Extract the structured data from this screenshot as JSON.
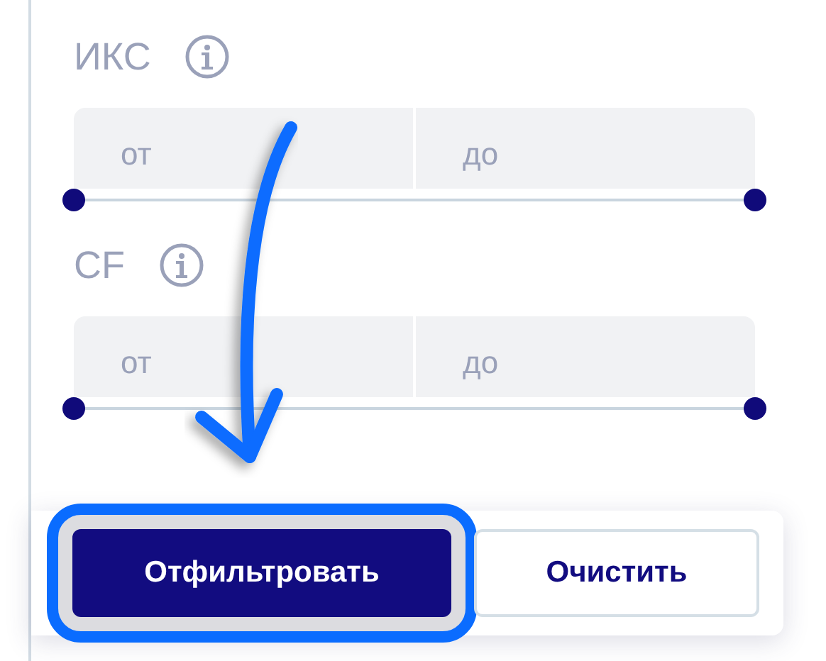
{
  "filters": [
    {
      "label": "ИКС",
      "from": {
        "placeholder": "от"
      },
      "to": {
        "placeholder": "до"
      },
      "slider": {
        "low": {
          "level": 0
        },
        "high": {
          "level": 1
        }
      }
    },
    {
      "label": "CF",
      "from": {
        "placeholder": "от"
      },
      "to": {
        "placeholder": "до"
      },
      "slider": {
        "low": {
          "level": 0
        },
        "high": {
          "level": 1
        }
      }
    }
  ],
  "buttons": [
    {
      "label": "Отфильтровать",
      "kind": "primary",
      "highlighted": true
    },
    {
      "label": "Очистить",
      "kind": "secondary",
      "highlighted": false
    }
  ]
}
